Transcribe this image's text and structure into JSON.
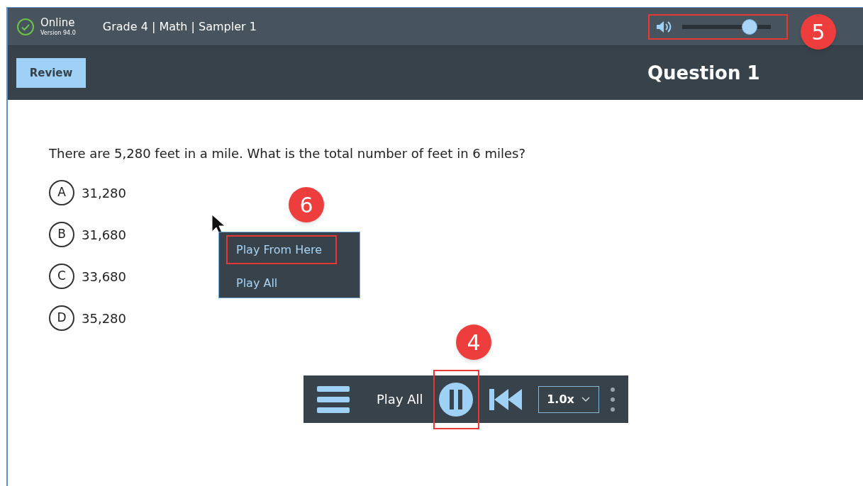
{
  "header": {
    "status": "Online",
    "version": "Version 94.0",
    "title": "Grade 4 | Math | Sampler 1",
    "volume": {
      "level": 0.76,
      "callout": "5"
    }
  },
  "subheader": {
    "review_button": "Review",
    "question_title": "Question 1"
  },
  "question": {
    "text": "There are 5,280 feet in a mile. What is the total number of feet in 6 miles?",
    "options": [
      {
        "letter": "A",
        "text": "31,280",
        "selected": false
      },
      {
        "letter": "B",
        "text": "31,680",
        "selected": false
      },
      {
        "letter": "C",
        "text": "33,680",
        "selected": false
      },
      {
        "letter": "D",
        "text": "35,280",
        "selected": false
      }
    ]
  },
  "context_menu": {
    "callout": "6",
    "items": [
      {
        "label": "Play From Here",
        "outlined": true
      },
      {
        "label": "Play All",
        "outlined": false
      }
    ]
  },
  "audio_toolbar": {
    "label": "Play All",
    "playing": true,
    "speed": "1.0x",
    "callout": "4"
  }
}
